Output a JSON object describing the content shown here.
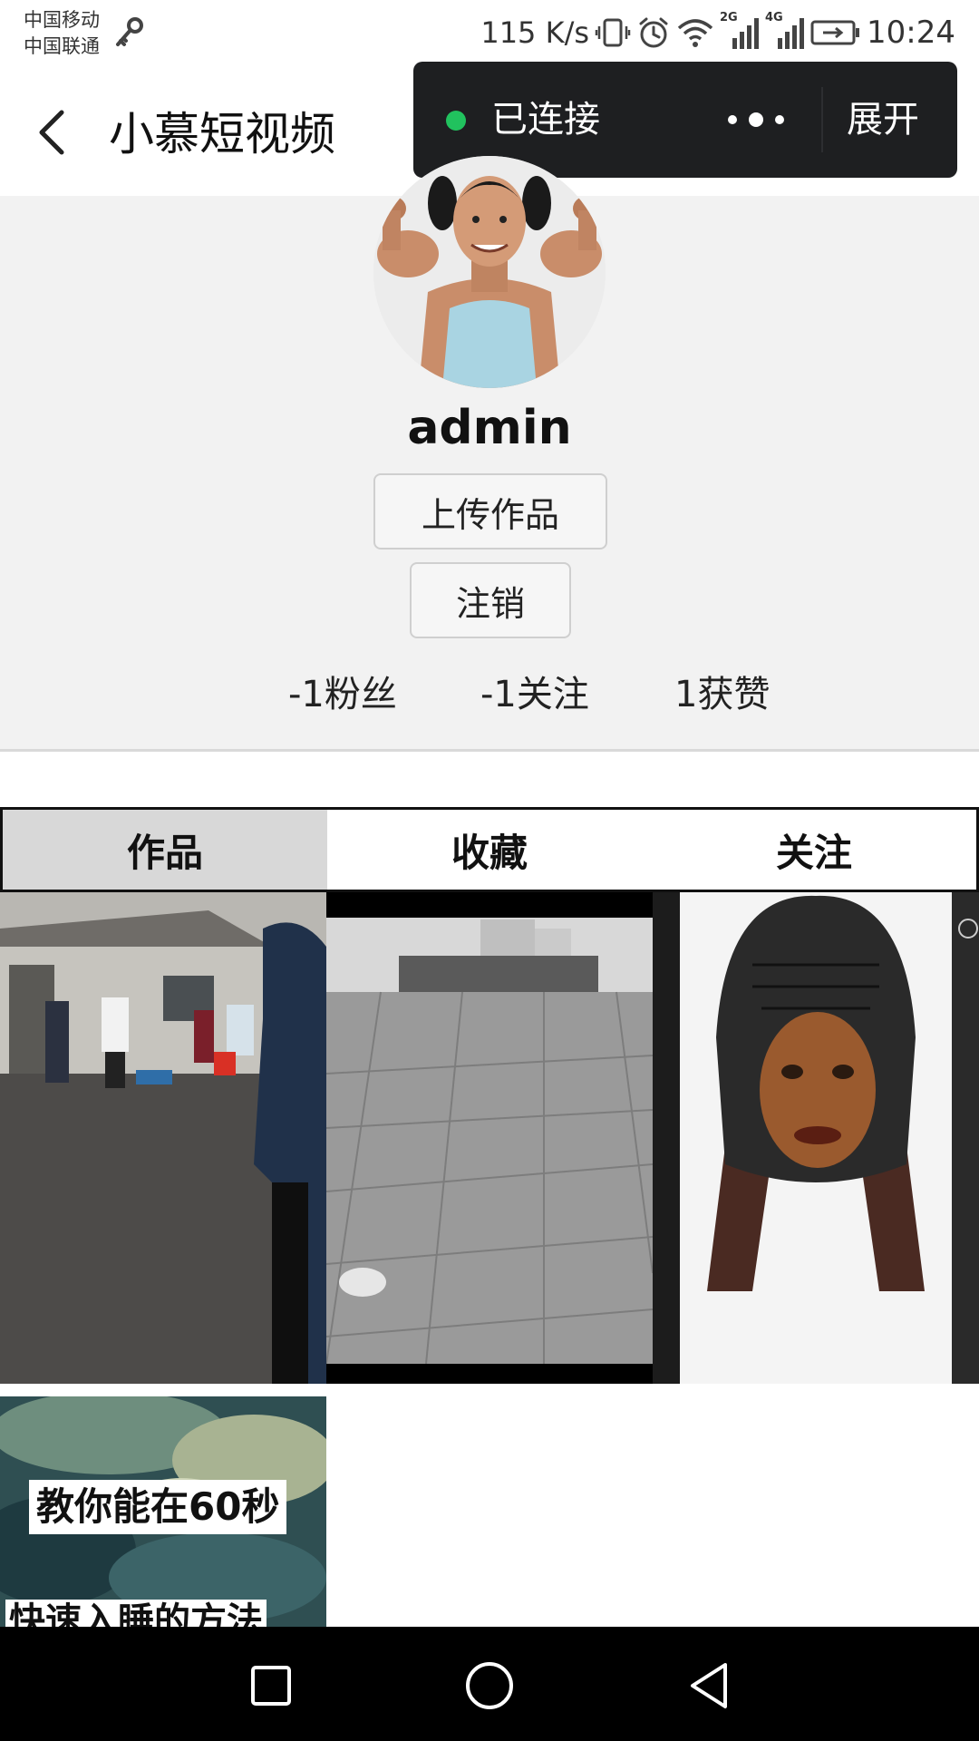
{
  "status_bar": {
    "carrier_1": "中国移动",
    "carrier_2": "中国联通",
    "speed": "115 K/s",
    "net_2g": "2G",
    "net_4g": "4G",
    "time": "10:24"
  },
  "header": {
    "title": "小慕短视频"
  },
  "connection": {
    "status": "已连接",
    "expand": "展开",
    "status_color": "#21c25e"
  },
  "profile": {
    "username": "admin",
    "upload_label": "上传作品",
    "logout_label": "注销",
    "fans": "-1粉丝",
    "following": "-1关注",
    "likes": "1获赞"
  },
  "tabs": [
    "作品",
    "收藏",
    "关注"
  ],
  "videos": [
    {},
    {},
    {},
    {
      "caption": "教你能在60秒",
      "caption_2": "快速入睡的方法"
    }
  ],
  "icons": [
    "key-icon",
    "vibrate-icon",
    "alarm-icon",
    "wifi-icon",
    "signal-icon",
    "battery-icon",
    "back-arrow-icon",
    "more-icon",
    "recent-apps-icon",
    "home-icon",
    "nav-back-icon"
  ]
}
